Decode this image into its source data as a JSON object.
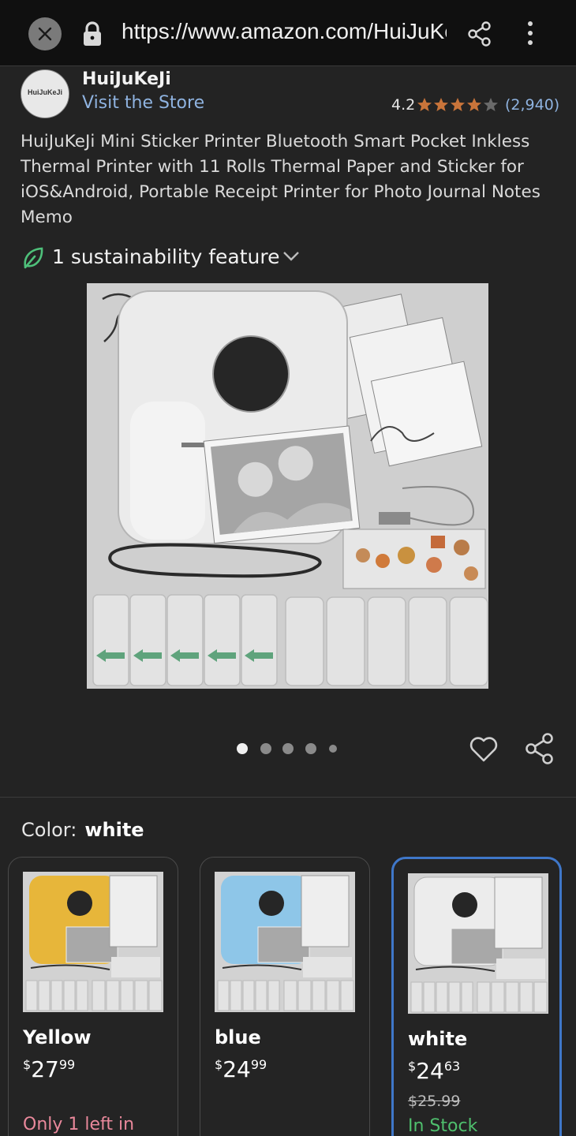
{
  "browser": {
    "url": "https://www.amazon.com/HuiJuKeJi-Mini-Sticker-Printer",
    "icons": [
      "close-icon",
      "lock-icon",
      "share-icon",
      "more-vert-icon"
    ]
  },
  "brand": {
    "logo_text": "HuiJuKeJi",
    "name": "HuiJuKeJi",
    "visit_store": "Visit the Store",
    "rating": "4.2",
    "stars": 4.2,
    "review_count": "(2,940)"
  },
  "product": {
    "title": "HuiJuKeJi Mini Sticker Printer Bluetooth Smart Pocket Inkless Thermal Printer with 11 Rolls Thermal Paper and Sticker for iOS&Android, Portable Receipt Printer for Photo Journal Notes Memo",
    "sustainability": "1 sustainability feature",
    "image_count": 5,
    "active_image": 0
  },
  "colors": {
    "label": "Color:",
    "selected": "white",
    "accent_selected": "#3f77c9",
    "options": [
      {
        "name": "Yellow",
        "currency": "$",
        "dollars": "27",
        "cents": "99",
        "old_price": "",
        "stock": "Only 1 left in",
        "stock_type": "low",
        "swatch": "#e7b63a"
      },
      {
        "name": "blue",
        "currency": "$",
        "dollars": "24",
        "cents": "99",
        "old_price": "",
        "stock": "",
        "stock_type": "",
        "swatch": "#8ec6e8"
      },
      {
        "name": "white",
        "currency": "$",
        "dollars": "24",
        "cents": "63",
        "old_price": "$25.99",
        "stock": "In Stock",
        "stock_type": "in",
        "swatch": "#e9e9e9"
      }
    ]
  }
}
